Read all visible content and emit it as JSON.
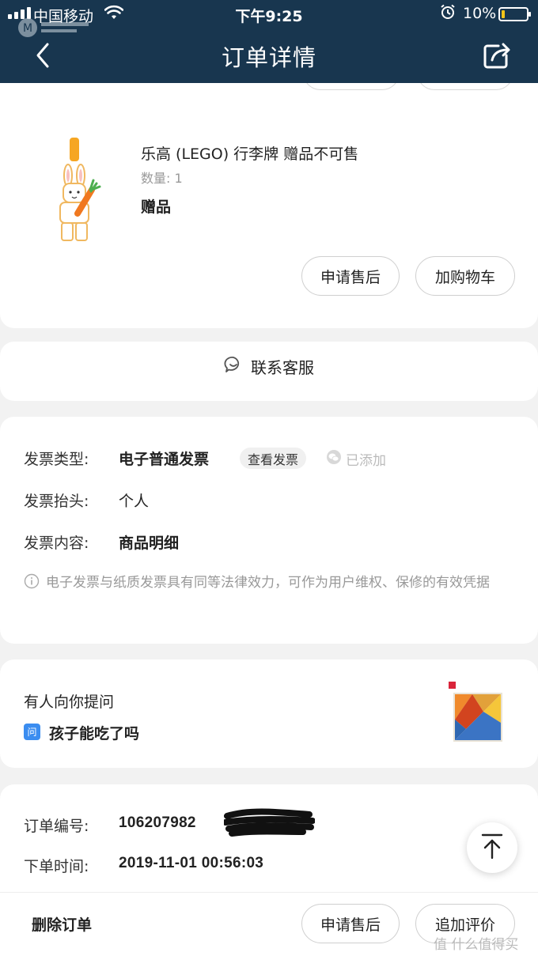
{
  "status_bar": {
    "carrier": "中国移动",
    "time": "下午9:25",
    "battery_percent": "10%"
  },
  "nav": {
    "title": "订单详情"
  },
  "product": {
    "name": "乐高 (LEGO) 行李牌 赠品不可售",
    "quantity": "数量: 1",
    "tag": "赠品",
    "hidden_buttons": [
      "申请售后",
      "加购物车"
    ],
    "buttons": {
      "after_sale": "申请售后",
      "add_cart": "加购物车"
    }
  },
  "service": {
    "label": "联系客服"
  },
  "invoice": {
    "type_label": "发票类型:",
    "type_value": "电子普通发票",
    "view_button": "查看发票",
    "added": "已添加",
    "title_label": "发票抬头:",
    "title_value": "个人",
    "content_label": "发票内容:",
    "content_value": "商品明细",
    "note": "电子发票与纸质发票具有同等法律效力，可作为用户维权、保修的有效凭据"
  },
  "qa": {
    "title": "有人向你提问",
    "badge": "问",
    "question": "孩子能吃了吗"
  },
  "order_info": {
    "number_label": "订单编号:",
    "number_value": "106207982",
    "time_label": "下单时间:",
    "time_value": "2019-11-01 00:56:03"
  },
  "bottom_bar": {
    "delete": "删除订单",
    "after_sale": "申请售后",
    "review": "追加评价"
  },
  "watermark": "值 什么值得买",
  "colors": {
    "header_bg": "#18364f",
    "qa_badge": "#3b8df0",
    "battery_fill": "#f5c518"
  }
}
